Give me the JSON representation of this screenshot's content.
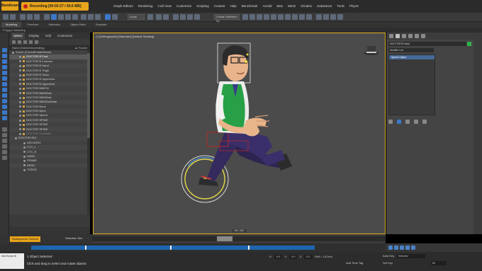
{
  "app": {
    "logo": "Bandicam",
    "recording": "Recording [00:02:27 / 60.6 MB]"
  },
  "menu": [
    "Graph Editors",
    "Rendering",
    "Civil View",
    "Customize",
    "Scripting",
    "Content",
    "Help",
    "Benchmark",
    "Arnold",
    "Max",
    "Mesh",
    "Ornatrix",
    "Substance",
    "Tools",
    "PhysX"
  ],
  "toolbar": {
    "view_select": "Local",
    "selection_set": "Create Selection Se"
  },
  "ribbon": {
    "tabs": [
      "Modeling",
      "Freeform",
      "Selection",
      "Object Paint",
      "Populate"
    ],
    "sub": "Polygon Modeling"
  },
  "explorer": {
    "tabs": [
      "Select",
      "Display",
      "Edit",
      "Customize"
    ],
    "header_left": "Name (Sorted Ascending)",
    "header_right": "▲ Frozen",
    "rows": [
      "Scene (CurrentFolderName)",
      "DOCTOR B Foot",
      "DOCTOR B Forearm",
      "DOCTOR B Hand",
      "DOCTOR B Thigh",
      "DOCTOR B Torso",
      "DOCTOR B UpperArm",
      "DOCTOR B UpperArm",
      "DOCTOR BNECK",
      "DOCTOR BMIDDab",
      "DOCTOR BMIDDab",
      "DOCTOR BMIDDaeNab",
      "DOCTOR Bone",
      "DOCTOR Bone",
      "DOCTOR Speed",
      "DOCTOR SPINE",
      "DOCTOR SPINE",
      "DOCTOR SPINE",
      "DOCTOR Controller",
      "DOCTOR RIG",
      "ARCHDRV",
      "CTC_L",
      "CTC_R",
      "HAND",
      "FRAME",
      "HEAD",
      "TORSO"
    ]
  },
  "viewport": {
    "label": "[+] [Orthographic] [Standard] [Default Shading]",
    "frame": "69 / 100"
  },
  "command_panel": {
    "object_name": "DOCTOR B Head",
    "modifier_list": "Modifier List",
    "stack_item": "Speed Object"
  },
  "bottom": {
    "workspace": "Workspaces: Default",
    "selection_set": "Selection Set:",
    "status1": "1 Object Selected",
    "status2": "Click and drag to select and rotate objects",
    "script_label": "MAXScript Mi",
    "coords": {
      "x_label": "X:",
      "x": "0.0",
      "y_label": "Y:",
      "y": "0.0",
      "z_label": "Z:",
      "z": "0.0"
    },
    "grid": "Grid = 10,0cm",
    "add_time_tag": "Add Time Tag",
    "auto_key": "Auto Key",
    "set_key": "Set Key",
    "key_filter": "Selected",
    "frame": "69"
  },
  "colors": {
    "accent": "#e8a41a",
    "viewport_border": "#e0b020",
    "selection_blue": "#1e66b0",
    "vest": "#27a047"
  }
}
